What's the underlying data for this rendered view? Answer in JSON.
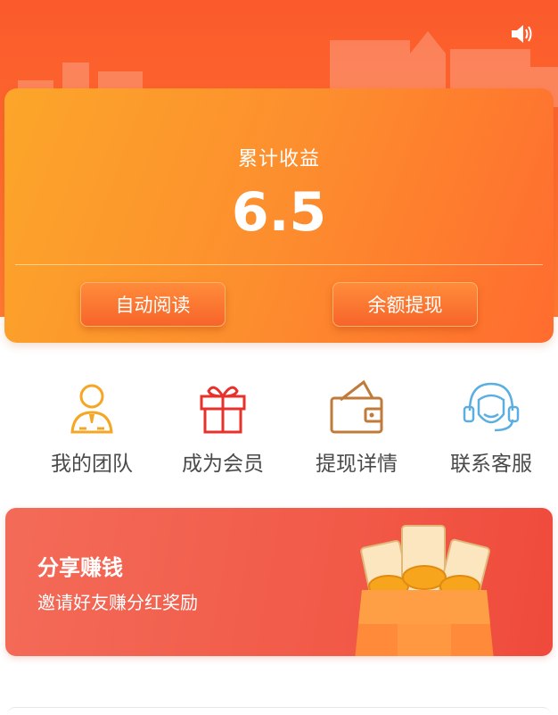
{
  "header": {
    "sound_icon": "speaker-icon",
    "bg_color": "#fb5a2c"
  },
  "earnings": {
    "label": "累计收益",
    "value": "6.5",
    "auto_read_label": "自动阅读",
    "withdraw_label": "余额提现"
  },
  "menu": [
    {
      "label": "我的团队",
      "icon": "team-person-icon",
      "color": "#f5a623"
    },
    {
      "label": "成为会员",
      "icon": "gift-icon",
      "color": "#e8312b"
    },
    {
      "label": "提现详情",
      "icon": "wallet-icon",
      "color": "#c07a3a"
    },
    {
      "label": "联系客服",
      "icon": "headset-icon",
      "color": "#5aaee0"
    }
  ],
  "share": {
    "title": "分享赚钱",
    "subtitle": "邀请好友赚分红奖励",
    "icon": "money-bag-icon"
  }
}
